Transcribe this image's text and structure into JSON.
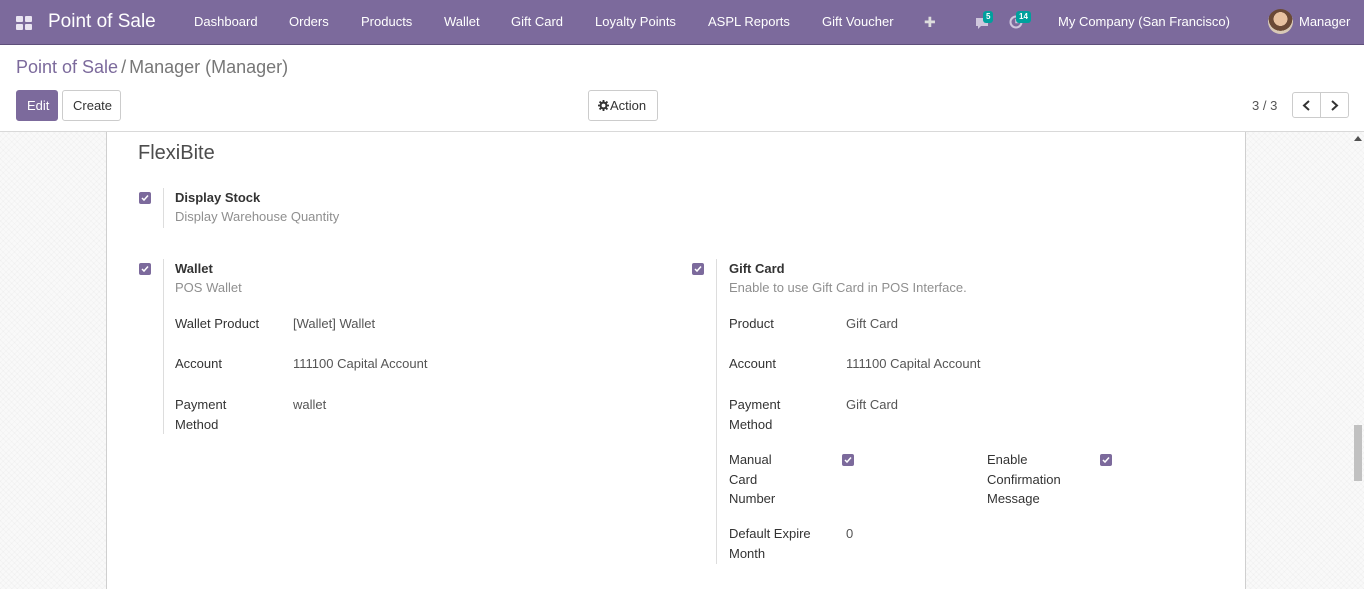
{
  "navbar": {
    "brand": "Point of Sale",
    "menu": [
      "Dashboard",
      "Orders",
      "Products",
      "Wallet",
      "Gift Card",
      "Loyalty Points",
      "ASPL Reports",
      "Gift Voucher"
    ],
    "add_glyph": "✚",
    "messages_count": "5",
    "activities_count": "14",
    "company": "My Company (San Francisco)",
    "user": "Manager",
    "icons": [
      "apps-icon",
      "plus-icon",
      "chat-icon",
      "clock-icon",
      "avatar"
    ]
  },
  "breadcrumb": {
    "parent": "Point of Sale",
    "separator": "/",
    "current": "Manager (Manager)"
  },
  "toolbar": {
    "edit_label": "Edit",
    "create_label": "Create",
    "action_label": "Action",
    "pager": "3 / 3"
  },
  "form": {
    "section_title": "FlexiBite",
    "display_stock": {
      "title": "Display Stock",
      "help": "Display Warehouse Quantity",
      "checked": true
    },
    "wallet": {
      "title": "Wallet",
      "help": "POS Wallet",
      "checked": true,
      "fields": [
        {
          "label": "Wallet Product",
          "value": "[Wallet] Wallet"
        },
        {
          "label": "Account",
          "value": "111100 Capital Account"
        },
        {
          "label": "Payment Method",
          "value": "wallet"
        }
      ]
    },
    "gift_card": {
      "title": "Gift Card",
      "help": "Enable to use Gift Card in POS Interface.",
      "checked": true,
      "fields": [
        {
          "label": "Product",
          "value": "Gift Card"
        },
        {
          "label": "Account",
          "value": "111100 Capital Account"
        },
        {
          "label": "Payment Method",
          "value": "Gift Card"
        }
      ],
      "manual_card_number_label": "Manual Card Number",
      "manual_card_number_checked": true,
      "enable_confirmation_label": "Enable Confirmation Message",
      "enable_confirmation_checked": true,
      "default_expire_label": "Default Expire Month",
      "default_expire_value": "0"
    }
  },
  "colors": {
    "brand": "#7c6a9c",
    "badge": "#00a09d"
  }
}
